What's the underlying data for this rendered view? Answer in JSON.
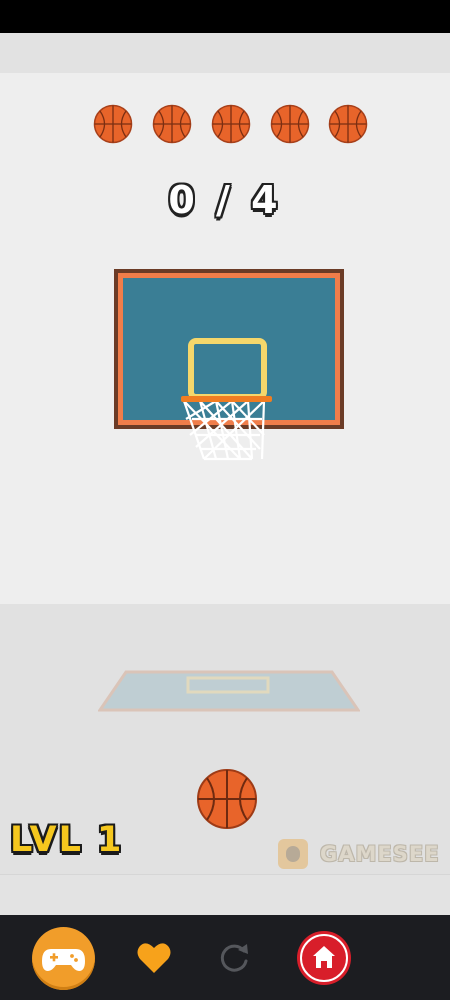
{
  "game": {
    "score_text": "0 / 4",
    "lives_remaining": 5,
    "level_text": "LVL 1",
    "watermark_text": "GAMESEE"
  },
  "colors": {
    "ball_orange": "#e8642a",
    "backboard_blue": "#3a7e95",
    "backboard_frame": "#6b3b26",
    "rim_orange": "#f07d22",
    "target_box_yellow": "#f5d76b",
    "level_yellow": "#f5c71e",
    "nav_background": "#1c1d21",
    "games_button": "#f19d2a",
    "favorite_heart": "#f7a21b",
    "home_button": "#d81e2a"
  },
  "nav": {
    "items": [
      {
        "icon": "gamepad-icon"
      },
      {
        "icon": "heart-icon"
      },
      {
        "icon": "restart-icon"
      },
      {
        "icon": "home-icon"
      }
    ]
  }
}
